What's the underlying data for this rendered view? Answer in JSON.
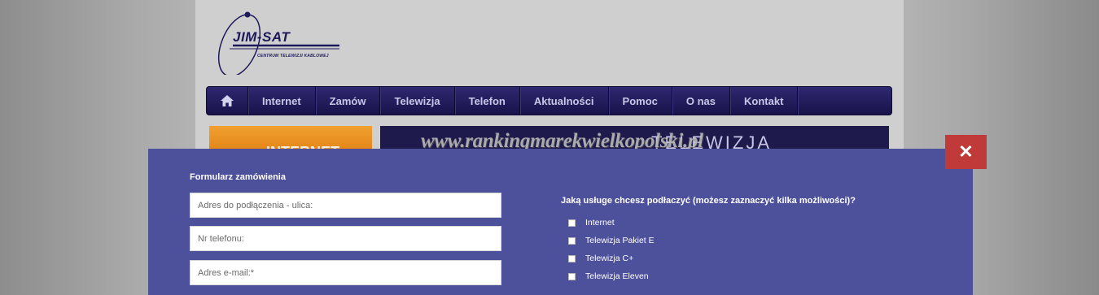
{
  "logo": {
    "brand": "JIM-SAT",
    "tagline": "CENTRUM TELEWIZJI KABLOWEJ"
  },
  "nav": {
    "home_icon": "home-icon",
    "items": [
      "Internet",
      "Zamów",
      "Telewizja",
      "Telefon",
      "Aktualności",
      "Pomoc",
      "O nas",
      "Kontakt"
    ]
  },
  "banner": {
    "right_text": "TELEWIZJA",
    "left_text": "INTERNET"
  },
  "watermark": "www.rankingmarekwielkopolski.pl",
  "modal": {
    "close_icon": "close-icon",
    "close_label": "✕",
    "form_title": "Formularz zamówienia",
    "fields": [
      {
        "placeholder": "Adres do podłączenia - ulica:"
      },
      {
        "placeholder": "Nr telefonu:"
      },
      {
        "placeholder": "Adres e-mail:*"
      }
    ],
    "services_question": "Jaką usługe chcesz podłaczyć (możesz zaznaczyć kilka możliwości)?",
    "services": [
      "Internet",
      "Telewizja Pakiet E",
      "Telewizja C+",
      "Telewizja Eleven"
    ]
  },
  "colors": {
    "nav_bg": "#1f1a55",
    "modal_bg": "#4d509b",
    "close_bg": "#c03a3a"
  }
}
